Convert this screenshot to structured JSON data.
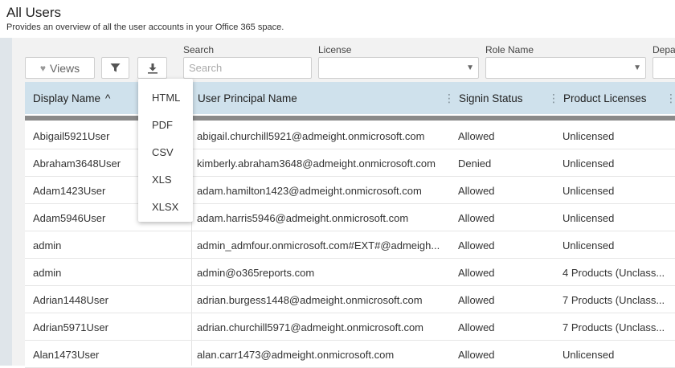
{
  "page": {
    "title": "All Users",
    "subtitle": "Provides an overview of all the user accounts in your Office 365 space."
  },
  "toolbar": {
    "views_label": "Views",
    "filter_icon": "filter-icon",
    "download_icon": "download-icon"
  },
  "filters": {
    "search_label": "Search",
    "search_placeholder": "Search",
    "license_label": "License",
    "license_value": "",
    "role_label": "Role Name",
    "role_value": "",
    "dept_label": "Depa"
  },
  "columns": [
    {
      "label": "Display Name",
      "sort": "^"
    },
    {
      "label": "User Principal Name"
    },
    {
      "label": "Signin Status"
    },
    {
      "label": "Product Licenses"
    }
  ],
  "export_menu": [
    "HTML",
    "PDF",
    "CSV",
    "XLS",
    "XLSX"
  ],
  "rows": [
    {
      "display_name": "Abigail5921User",
      "upn": "abigail.churchill5921@admeight.onmicrosoft.com",
      "status": "Allowed",
      "licenses": "Unlicensed"
    },
    {
      "display_name": "Abraham3648User",
      "upn": "kimberly.abraham3648@admeight.onmicrosoft.com",
      "status": "Denied",
      "licenses": "Unlicensed"
    },
    {
      "display_name": "Adam1423User",
      "upn": "adam.hamilton1423@admeight.onmicrosoft.com",
      "status": "Allowed",
      "licenses": "Unlicensed"
    },
    {
      "display_name": "Adam5946User",
      "upn": "adam.harris5946@admeight.onmicrosoft.com",
      "status": "Allowed",
      "licenses": "Unlicensed"
    },
    {
      "display_name": "admin",
      "upn": "admin_admfour.onmicrosoft.com#EXT#@admeigh...",
      "status": "Allowed",
      "licenses": "Unlicensed"
    },
    {
      "display_name": "admin",
      "upn": "admin@o365reports.com",
      "status": "Allowed",
      "licenses": "4 Products (Unclass..."
    },
    {
      "display_name": "Adrian1448User",
      "upn": "adrian.burgess1448@admeight.onmicrosoft.com",
      "status": "Allowed",
      "licenses": "7 Products (Unclass..."
    },
    {
      "display_name": "Adrian5971User",
      "upn": "adrian.churchill5971@admeight.onmicrosoft.com",
      "status": "Allowed",
      "licenses": "7 Products (Unclass..."
    },
    {
      "display_name": "Alan1473User",
      "upn": "alan.carr1473@admeight.onmicrosoft.com",
      "status": "Allowed",
      "licenses": "Unlicensed"
    }
  ]
}
